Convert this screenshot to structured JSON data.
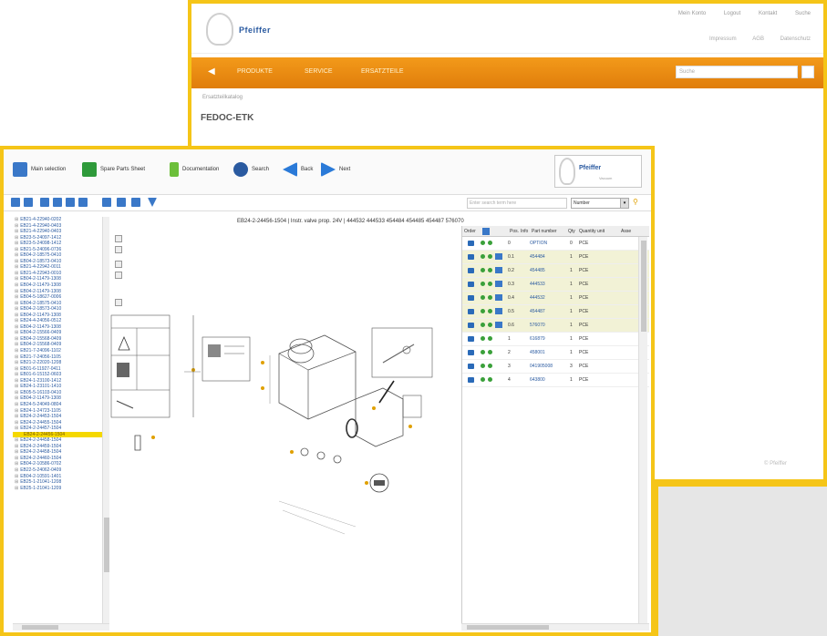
{
  "back_window": {
    "logo_text": "Pfeiffer",
    "top_links": [
      "Mein Konto",
      "Logout",
      "Kontakt",
      "Suche"
    ],
    "top_links2": [
      "Impressum",
      "AGB",
      "Datenschutz"
    ],
    "nav_items": [
      "PRODUKTE",
      "SERVICE",
      "ERSATZTEILE"
    ],
    "search_placeholder": "Suche",
    "breadcrumb": "Ersatzteilkatalog",
    "title": "FEDOC-ETK",
    "footer": "© Pfeiffer"
  },
  "toolbar": {
    "main_selection": "Main selection",
    "spare_parts_sheet": "Spare Parts Sheet",
    "documentation": "Documentation",
    "search": "Search",
    "back": "Back",
    "next": "Next",
    "logo_text": "Pfeiffer",
    "logo_sub": "Vacuum"
  },
  "filter": {
    "input_placeholder": "Enter search term here",
    "select_value": "Number"
  },
  "drawing": {
    "title": "EB24-2-24456-1504 | Instr. valve prop. 24V | 444532 444533 454484 454485 454487 576070"
  },
  "tree": [
    "EB21-4-22940-0202",
    "EB21-4-22940-0403",
    "EB21-4-22940-0403",
    "EB23-5-24097-1412",
    "EB23-5-24098-1412",
    "EB21-5-24096-0736",
    "EB04-2-18575-0410",
    "EB04-2-18573-0410",
    "EB21-4-22942-0011",
    "EB21-4-22943-0010",
    "EB04-2-11479-1308",
    "EB04-2-11479-1308",
    "EB04-2-11479-1308",
    "EB04-5-18627-0006",
    "EB04-2-18575-0410",
    "EB04-2-18573-0410",
    "EB04-2-11479-1308",
    "EB24-4-24056-0512",
    "EB04-2-11479-1308",
    "EB04-2-15566-0409",
    "EB04-2-15568-0409",
    "EB04-2-15568-0409",
    "EB21-7-24096-1102",
    "EB21-7-24056-1105",
    "EB21-2-22020-1208",
    "EB01-6-11927-0411",
    "EB01-6-15152-0603",
    "EB24-1-23100-1412",
    "EB24-1-23101-1410",
    "EB05-5-16103-0410",
    "EB04-2-11479-1308",
    "EB24-5-24049-0804",
    "EB24-1-24723-1105",
    "EB24-2-24453-1504",
    "EB24-2-24455-1504",
    "EB24-2-24457-1504",
    "EB24-2-24456-1504",
    "EB24-2-24458-1504",
    "EB24-2-24459-1504",
    "EB24-2-24458-1504",
    "EB24-2-24460-1504",
    "EB04-2-10586-0702",
    "EB22-5-24062-0409",
    "EB04-2-10591-1401",
    "EB25-1-21041-1208",
    "EB25-1-21041-1209"
  ],
  "tree_selected_index": 36,
  "parts_header": [
    "Order",
    "Pos.",
    "Info",
    "Part number",
    "Qty",
    "Quantity unit",
    "Asse"
  ],
  "parts": [
    {
      "pos": "0",
      "num": "OPTION",
      "qty": "0",
      "unit": "PCE",
      "hl": false
    },
    {
      "pos": "0.1",
      "num": "454484",
      "qty": "1",
      "unit": "PCE",
      "hl": true
    },
    {
      "pos": "0.2",
      "num": "454485",
      "qty": "1",
      "unit": "PCE",
      "hl": true
    },
    {
      "pos": "0.3",
      "num": "444533",
      "qty": "1",
      "unit": "PCE",
      "hl": true
    },
    {
      "pos": "0.4",
      "num": "444532",
      "qty": "1",
      "unit": "PCE",
      "hl": true
    },
    {
      "pos": "0.5",
      "num": "454487",
      "qty": "1",
      "unit": "PCE",
      "hl": true
    },
    {
      "pos": "0.6",
      "num": "576070",
      "qty": "1",
      "unit": "PCE",
      "hl": true
    },
    {
      "pos": "1",
      "num": "616879",
      "qty": "1",
      "unit": "PCE",
      "hl": false
    },
    {
      "pos": "2",
      "num": "458001",
      "qty": "1",
      "unit": "PCE",
      "hl": false
    },
    {
      "pos": "3",
      "num": "041905008",
      "qty": "3",
      "unit": "PCE",
      "hl": false
    },
    {
      "pos": "4",
      "num": "643800",
      "qty": "1",
      "unit": "PCE",
      "hl": false
    }
  ],
  "colors": {
    "accent": "#f5c518",
    "orange": "#f39a1a",
    "link": "#2a5aa0"
  }
}
